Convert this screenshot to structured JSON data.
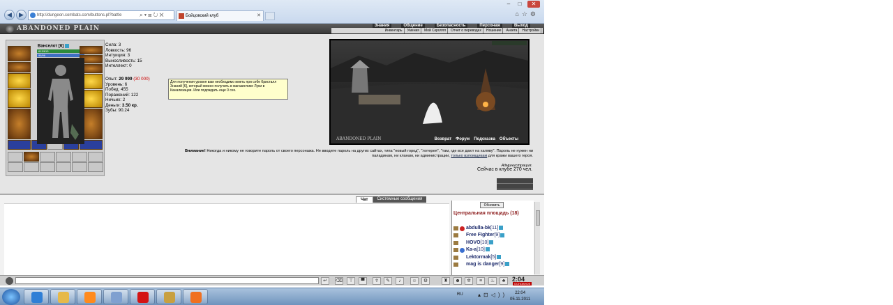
{
  "browser": {
    "url": "http://dungeon.combats.com/buttons.pl?battle",
    "tab_title": "Бойцовский клуб",
    "window_controls": [
      "minimize-icon",
      "maximize-icon",
      "close-icon"
    ]
  },
  "game": {
    "logo": "ABANDONED PLAIN",
    "top_menu": [
      "Знания",
      "Общение",
      "Безопасность",
      "Персонаж",
      "Выход"
    ],
    "sub_menu": [
      "Инвентарь",
      "Умения",
      "Мой Скроллл",
      "Отчет о переводах",
      "Ношение",
      "Анкета",
      "Настройки"
    ]
  },
  "character": {
    "name": "Ванселот",
    "level": "[6]",
    "hp": "613/613",
    "mana": "96/96",
    "stats": [
      {
        "label": "Сила:",
        "value": "3"
      },
      {
        "label": "Ловкость:",
        "value": "96"
      },
      {
        "label": "Интуиция:",
        "value": "3"
      },
      {
        "label": "Выносливость:",
        "value": "15"
      },
      {
        "label": "Интеллект:",
        "value": "0"
      }
    ],
    "exp_label": "Опыт:",
    "exp_value": "29 999",
    "exp_next": "(30 000)",
    "details": [
      {
        "label": "Уровень:",
        "value": "6"
      },
      {
        "label": "Побед:",
        "value": "455"
      },
      {
        "label": "Поражений:",
        "value": "122"
      },
      {
        "label": "Ничьих:",
        "value": "2"
      },
      {
        "label": "Деньги:",
        "value": "3.50 кр."
      },
      {
        "label": "Зубы:",
        "value": "90.24"
      }
    ]
  },
  "tooltip": "Для получения уровня вам необходимо иметь при себе Кристалл Знаний [6], который можно получить в магазинчике Луки в Канализации. Или подождать еще 0 сек.",
  "scene": {
    "logo": "ABANDONED PLAIN",
    "links": [
      "Возврат",
      "Форум",
      "Подсказка",
      "Объекты"
    ]
  },
  "warning": {
    "prefix": "Внимание!",
    "text": "Никогда и никому не говорите пароль от своего персонажа. Не вводите пароль на других сайтах, типа \"новый город\", \"лотерея\", \"там, где все дают на халяву\". Пароль не нужен ни паладинам, ни кланам, ни администрации,",
    "link": "только взломщикам",
    "tail": "для кражи вашего героя.",
    "signature": "Администрация.",
    "online": "Сейчас в клубе 270 чел."
  },
  "chat": {
    "tabs": [
      "Чат",
      "Системные сообщения"
    ],
    "refresh": "Обновить",
    "room": "Центральная площадь (18)",
    "players": [
      {
        "name": "abdulla-bk",
        "level": "[11]",
        "badge": "#c22"
      },
      {
        "name": "Free Fighter",
        "level": "[9]",
        "badge": ""
      },
      {
        "name": "HOVO",
        "level": "[10]",
        "badge": ""
      },
      {
        "name": "Ka-a",
        "level": "[10]",
        "badge": "#3a6fd0"
      },
      {
        "name": "Lektormak",
        "level": "[5]",
        "badge": ""
      },
      {
        "name": "mag is danger",
        "level": "[9]",
        "badge": ""
      }
    ]
  },
  "clock": {
    "time": "2:04",
    "label": "ОСНОВНОЕ"
  },
  "taskbar": {
    "lang": "RU",
    "time": "22:04",
    "date": "05.11.2011",
    "apps": [
      {
        "name": "internet-explorer",
        "color": "#2f7fd6"
      },
      {
        "name": "explorer",
        "color": "#e6b94a"
      },
      {
        "name": "media-player",
        "color": "#ff8a1e"
      },
      {
        "name": "unknown-app",
        "color": "#7fa0d0"
      },
      {
        "name": "opera",
        "color": "#d41414"
      },
      {
        "name": "combats-client",
        "color": "#c8a040"
      },
      {
        "name": "mail-agent",
        "color": "#f07020"
      }
    ]
  }
}
